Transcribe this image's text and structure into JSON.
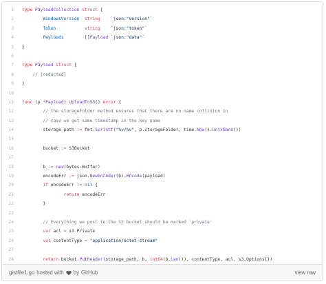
{
  "gist": {
    "lines": [
      [
        [
          "t",
          "type "
        ],
        [
          "f",
          "PayloadCollection"
        ],
        [
          "k",
          " struct"
        ],
        [
          "p",
          " {"
        ]
      ],
      [
        [
          "p",
          "        "
        ],
        [
          "e",
          "WindowsVersion"
        ],
        [
          "p",
          "  "
        ],
        [
          "t",
          "string"
        ],
        [
          "p",
          "    "
        ],
        [
          "s",
          "`json:\"version\"`"
        ]
      ],
      [
        [
          "p",
          "        "
        ],
        [
          "e",
          "Token"
        ],
        [
          "p",
          "           "
        ],
        [
          "t",
          "string"
        ],
        [
          "p",
          "    "
        ],
        [
          "s",
          "`json:\"token\"`"
        ]
      ],
      [
        [
          "p",
          "        "
        ],
        [
          "e",
          "Payloads"
        ],
        [
          "p",
          "        "
        ],
        [
          "p",
          "[]"
        ],
        [
          "f",
          "Payload"
        ],
        [
          "p",
          " "
        ],
        [
          "s",
          "`json:\"data\"`"
        ]
      ],
      [
        [
          "p",
          "}"
        ]
      ],
      [
        [
          "p",
          ""
        ]
      ],
      [
        [
          "t",
          "type "
        ],
        [
          "f",
          "Payload"
        ],
        [
          "k",
          " struct"
        ],
        [
          "p",
          " {"
        ]
      ],
      [
        [
          "c",
          "    // [redacted]"
        ]
      ],
      [
        [
          "p",
          "}"
        ]
      ],
      [
        [
          "p",
          ""
        ]
      ],
      [
        [
          "k",
          "func"
        ],
        [
          "p",
          " (p "
        ],
        [
          "k",
          "*"
        ],
        [
          "f",
          "Payload"
        ],
        [
          "p",
          ") "
        ],
        [
          "f",
          "UploadToS3"
        ],
        [
          "p",
          "() "
        ],
        [
          "t",
          "error"
        ],
        [
          "p",
          " {"
        ]
      ],
      [
        [
          "c",
          "        // the storageFolder method ensures that there are no name collision in"
        ]
      ],
      [
        [
          "c",
          "        // case we get same timestamp in the key name"
        ]
      ],
      [
        [
          "p",
          "        storage_path "
        ],
        [
          "k",
          ":="
        ],
        [
          "p",
          " fmt."
        ],
        [
          "f",
          "Sprintf"
        ],
        [
          "p",
          "("
        ],
        [
          "s",
          "\"%v/%v\""
        ],
        [
          "p",
          ", p.storageFolder, time."
        ],
        [
          "f",
          "Now"
        ],
        [
          "p",
          "()."
        ],
        [
          "f",
          "UnixNano"
        ],
        [
          "p",
          "())"
        ]
      ],
      [
        [
          "p",
          ""
        ]
      ],
      [
        [
          "p",
          "        bucket "
        ],
        [
          "k",
          ":="
        ],
        [
          "p",
          " S3Bucket"
        ]
      ],
      [
        [
          "p",
          ""
        ]
      ],
      [
        [
          "p",
          "        b "
        ],
        [
          "k",
          ":="
        ],
        [
          "p",
          " "
        ],
        [
          "f",
          "new"
        ],
        [
          "p",
          "(bytes.Buffer)"
        ]
      ],
      [
        [
          "p",
          "        encodeErr "
        ],
        [
          "k",
          ":="
        ],
        [
          "p",
          " json."
        ],
        [
          "f",
          "NewEncoder"
        ],
        [
          "p",
          "(b)."
        ],
        [
          "f",
          "Encode"
        ],
        [
          "p",
          "(payload)"
        ]
      ],
      [
        [
          "p",
          "        "
        ],
        [
          "k",
          "if"
        ],
        [
          "p",
          " encodeErr "
        ],
        [
          "k",
          "!="
        ],
        [
          "p",
          " "
        ],
        [
          "n",
          "nil"
        ],
        [
          "p",
          " {"
        ]
      ],
      [
        [
          "p",
          "                "
        ],
        [
          "k",
          "return"
        ],
        [
          "p",
          " encodeErr"
        ]
      ],
      [
        [
          "p",
          "        }"
        ]
      ],
      [
        [
          "p",
          ""
        ]
      ],
      [
        [
          "c",
          "        // Everything we post to the S3 bucket should be marked 'private'"
        ]
      ],
      [
        [
          "p",
          "        "
        ],
        [
          "k",
          "var"
        ],
        [
          "p",
          " acl "
        ],
        [
          "k",
          "="
        ],
        [
          "p",
          " s3.Private"
        ]
      ],
      [
        [
          "p",
          "        "
        ],
        [
          "k",
          "var"
        ],
        [
          "p",
          " contentType "
        ],
        [
          "k",
          "="
        ],
        [
          "p",
          " "
        ],
        [
          "s",
          "\"application/octet-stream\""
        ]
      ],
      [
        [
          "p",
          ""
        ]
      ],
      [
        [
          "p",
          "        "
        ],
        [
          "k",
          "return"
        ],
        [
          "p",
          " bucket."
        ],
        [
          "f",
          "PutReader"
        ],
        [
          "p",
          "(storage_path, b, "
        ],
        [
          "t",
          "int64"
        ],
        [
          "p",
          "(b."
        ],
        [
          "f",
          "Len"
        ],
        [
          "p",
          "()), contentType, acl, s3.Options{})"
        ]
      ],
      [
        [
          "p",
          "}"
        ]
      ]
    ]
  },
  "footer": {
    "filename": "gistfile1.go",
    "hosted_with": "hosted with",
    "by": "by",
    "github": "GitHub",
    "view_raw": "view raw"
  }
}
